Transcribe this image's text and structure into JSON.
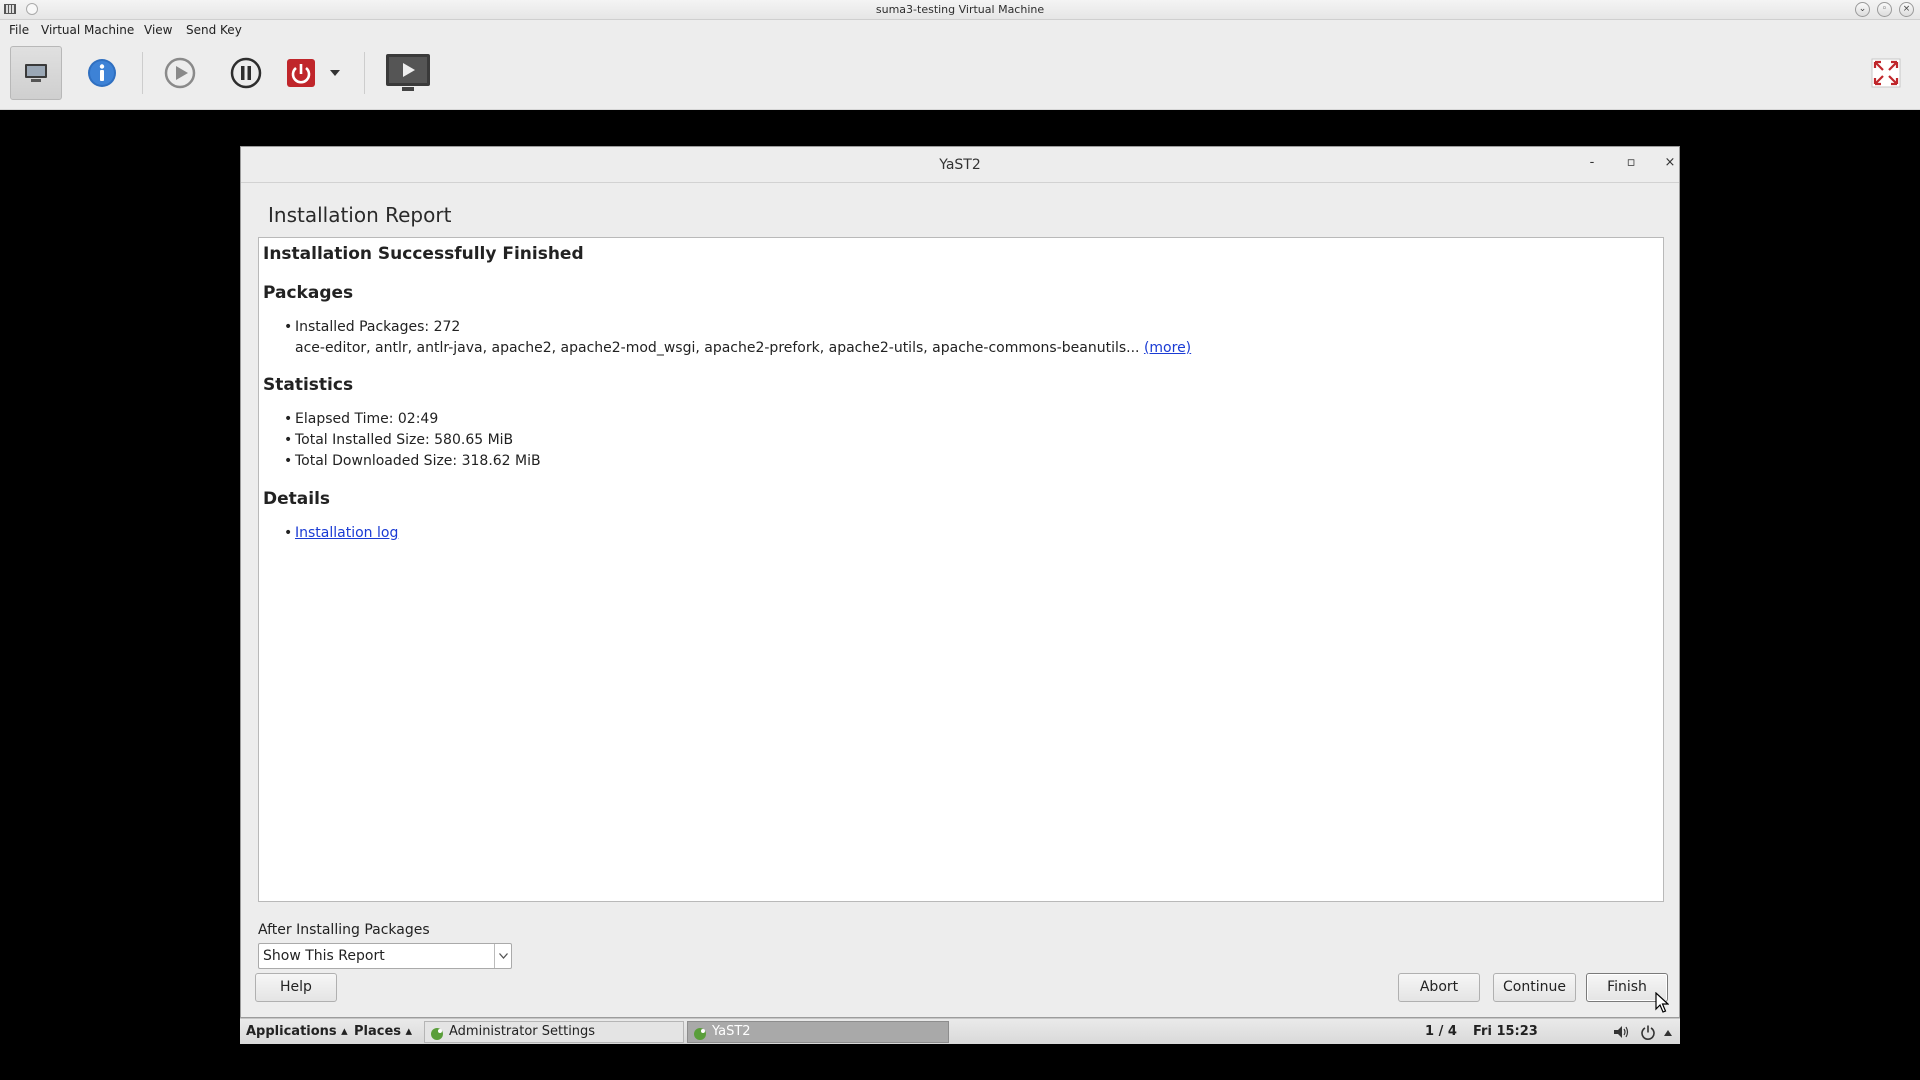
{
  "host": {
    "window_title": "suma3-testing Virtual Machine",
    "menu": [
      "File",
      "Virtual Machine",
      "View",
      "Send Key"
    ],
    "toolbar_icons": [
      "console-icon",
      "info-icon",
      "run-icon",
      "pause-icon",
      "power-icon",
      "dropdown-icon",
      "screenshot-icon",
      "fullscreen-icon"
    ]
  },
  "yast": {
    "window_title": "YaST2",
    "controls": {
      "minimize": "-",
      "maximize": "▫",
      "close": "×"
    },
    "page_heading": "Installation Report",
    "report": {
      "title": "Installation Successfully Finished",
      "packages_heading": "Packages",
      "installed_packages": "Installed Packages: 272",
      "package_list": "ace-editor, antlr, antlr-java, apache2, apache2-mod_wsgi, apache2-prefork, apache2-utils, apache-commons-beanutils...",
      "more_link": "(more)",
      "statistics_heading": "Statistics",
      "elapsed_time": "Elapsed Time: 02:49",
      "installed_size": "Total Installed Size: 580.65 MiB",
      "downloaded_size": "Total Downloaded Size: 318.62 MiB",
      "details_heading": "Details",
      "log_link": "Installation log"
    },
    "after_label": "After Installing Packages",
    "after_value": "Show This Report",
    "buttons": {
      "help": "Help",
      "abort": "Abort",
      "continue": "Continue",
      "finish": "Finish"
    }
  },
  "taskbar": {
    "applications": "Applications ▴",
    "places": "Places ▴",
    "window1": "Administrator Settings",
    "window2": "YaST2",
    "workspace": "1 / 4",
    "clock": "Fri 15:23"
  }
}
